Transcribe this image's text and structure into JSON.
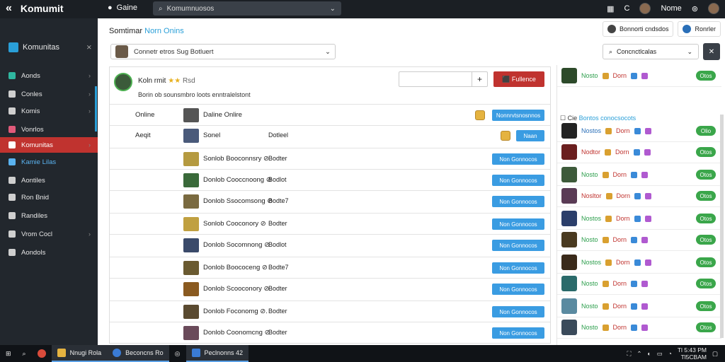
{
  "topbar": {
    "brand": "Komumit",
    "game": "Gaine",
    "search_placeholder": "Komumnuosos",
    "user": "Nome"
  },
  "sidebar": {
    "title": "Komunitas",
    "items": [
      {
        "label": "Aonds",
        "color": "#2fb7a0"
      },
      {
        "label": "Conles",
        "color": "#cfcfcf"
      },
      {
        "label": "Komis",
        "color": "#cfcfcf"
      },
      {
        "label": "Vonrlos",
        "color": "#e05a7a"
      },
      {
        "label": "Komunitas",
        "color": "#ffffff"
      },
      {
        "label": "Kamie Lilas",
        "color": "#5ab3f0"
      },
      {
        "label": "Aontiles",
        "color": "#cfcfcf"
      },
      {
        "label": "Ron Bnid",
        "color": "#cfcfcf"
      },
      {
        "label": "Randiles",
        "color": "#cfcfcf"
      },
      {
        "label": "Vrom Cocl",
        "color": "#cfcfcf"
      },
      {
        "label": "Aondols",
        "color": "#cfcfcf"
      }
    ]
  },
  "main": {
    "title_plain": "Somtimar",
    "title_highlight": "Norn Onins",
    "filter_left": "Connetr etros Sug Botluert",
    "btn_a": "Bonnorti cndsdos",
    "btn_b": "Ronrler",
    "filter_right": "Concnctlcalas",
    "profile_name": "Koln rmit",
    "profile_stars": "★★",
    "profile_sub": "Rsd",
    "profile_desc": "Borin ob sounsmbro loots enntralelstont",
    "follow_btn": "Fullence",
    "rows": [
      {
        "c1": "Online",
        "name": "Daline Onlire",
        "price": "",
        "btn": "Nonnrvtsnosnnos"
      },
      {
        "c1": "Aeqit",
        "name": "Sonel",
        "price": "Dotleel",
        "btn": "Naan"
      },
      {
        "c1": "",
        "name": "Sonlob Booconnsry ⊘",
        "price": "Bodter",
        "btn": "Non Gonnocos"
      },
      {
        "c1": "",
        "name": "Donlob Cooccnoong ⊘",
        "price": "Bodlot",
        "btn": "Non Gonnocos"
      },
      {
        "c1": "",
        "name": "Donlob Ssocomsong ⊘",
        "price": "Bodte7",
        "btn": "Non Gonnocos"
      },
      {
        "c1": "",
        "name": "Sonlob Cooconory ⊘",
        "price": "Bodter",
        "btn": "Non Gonnocos"
      },
      {
        "c1": "",
        "name": "Donlob Socomnong ⊘",
        "price": "Bodlot",
        "btn": "Non Gonnocos"
      },
      {
        "c1": "",
        "name": "Donlob Boococeng ⊘",
        "price": "Bodte7",
        "btn": "Non Gonnocos"
      },
      {
        "c1": "",
        "name": "Donlob Scooconory ⊘",
        "price": "Bodter",
        "btn": "Non Gonnocos"
      },
      {
        "c1": "",
        "name": "Donlob Foconomg ⊘.",
        "price": "Bodter",
        "btn": "Non Gonnocos"
      },
      {
        "c1": "",
        "name": "Donlob Coonomcng ⊘",
        "price": "Bodter",
        "btn": "Non Gonnocos"
      }
    ]
  },
  "right": {
    "sub_plain": "Cie",
    "sub_highlight": "Bontos conocsocots",
    "rows": [
      {
        "name": "Nosto",
        "nclass": "",
        "lvl": "Dorn",
        "btn": "Otos",
        "av": "#2d4a2a"
      },
      {
        "name": "Nostos",
        "nclass": "blue",
        "lvl": "Dorn",
        "btn": "Olio",
        "av": "#222"
      },
      {
        "name": "Nodtor",
        "nclass": "red",
        "lvl": "Dorn",
        "btn": "Otos",
        "av": "#6a1e1e"
      },
      {
        "name": "Nosto",
        "nclass": "",
        "lvl": "Dorn",
        "btn": "Otos",
        "av": "#3d5a3a"
      },
      {
        "name": "Nosltor",
        "nclass": "red",
        "lvl": "Dorn",
        "btn": "Otos",
        "av": "#5a3b55"
      },
      {
        "name": "Nostos",
        "nclass": "",
        "lvl": "Dorn",
        "btn": "Otos",
        "av": "#2b3e6a"
      },
      {
        "name": "Nosto",
        "nclass": "",
        "lvl": "Dorn",
        "btn": "Otos",
        "av": "#4a3a20"
      },
      {
        "name": "Nostos",
        "nclass": "",
        "lvl": "Dorn",
        "btn": "Otos",
        "av": "#3a2a1a"
      },
      {
        "name": "Nosto",
        "nclass": "",
        "lvl": "Dorn",
        "btn": "Otos",
        "av": "#2a6a6a"
      },
      {
        "name": "Nosto",
        "nclass": "",
        "lvl": "Dorn",
        "btn": "Otos",
        "av": "#5a8aa0"
      },
      {
        "name": "Nosto",
        "nclass": "",
        "lvl": "Dorn",
        "btn": "Otos",
        "av": "#3a4a5a"
      }
    ]
  },
  "taskbar": {
    "item1": "Nnugi Rola",
    "item2": "Beconcns Ro",
    "item3": "Peclnonns 42",
    "time": "Tl 5:43 PM",
    "date": "Tl5CBAM"
  }
}
